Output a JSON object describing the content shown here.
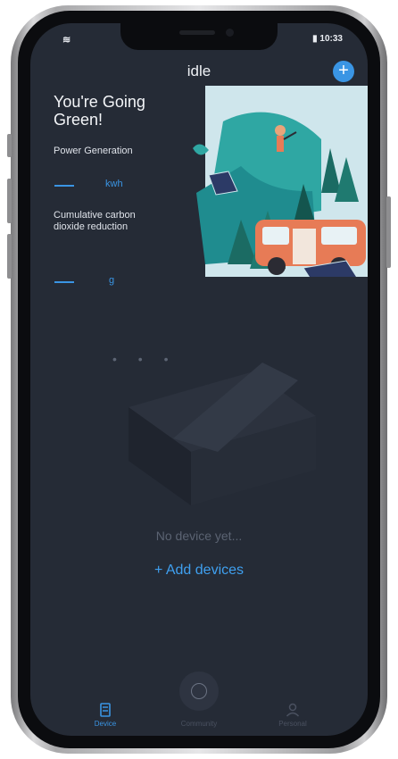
{
  "status_bar": {
    "left": "≋",
    "right": "▮ 10:33"
  },
  "header": {
    "title": "idle",
    "add_icon": "plus-icon",
    "add_label": "+"
  },
  "summary": {
    "heading": "You're Going Green!",
    "power_label": "Power Generation",
    "power_value": "--",
    "power_unit": "kwh",
    "carbon_label": "Cumulative carbon dioxide reduction",
    "carbon_value": "--",
    "carbon_unit": "g"
  },
  "empty_state": {
    "dots": "• • •",
    "message": "No device yet...",
    "add_label": "+ Add devices"
  },
  "tabbar": {
    "device_label": "Device",
    "community_label": "Community",
    "personal_label": "Personal",
    "active_color": "#3a95e4"
  },
  "colors": {
    "background": "#252b36",
    "accent": "#3a95e4"
  }
}
